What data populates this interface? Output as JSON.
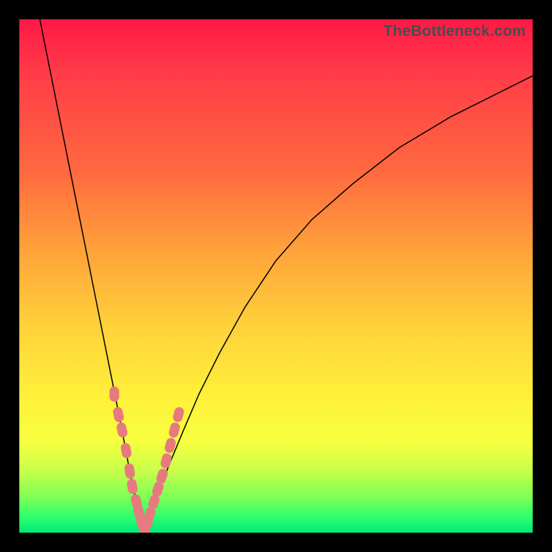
{
  "watermark": "TheBottleneck.com",
  "colors": {
    "frame": "#000000",
    "gradient_top": "#ff1846",
    "gradient_mid": "#fff13a",
    "gradient_bottom": "#00e877",
    "curve": "#000000",
    "points": "#e77a7f"
  },
  "chart_data": {
    "type": "line",
    "title": "",
    "xlabel": "",
    "ylabel": "",
    "xlim": [
      0,
      100
    ],
    "ylim": [
      0,
      100
    ],
    "grid": false,
    "series": [
      {
        "name": "left-branch",
        "x": [
          4,
          6,
          8,
          10,
          12,
          14,
          16,
          18,
          20,
          21.5,
          22.8,
          23.8,
          24.3
        ],
        "y": [
          100,
          90,
          80,
          70,
          60,
          50,
          40,
          30,
          20,
          12,
          6,
          2,
          0
        ]
      },
      {
        "name": "right-branch",
        "x": [
          24.3,
          25,
          26,
          27.5,
          29.5,
          32,
          35,
          39,
          44,
          50,
          57,
          65,
          74,
          84,
          94,
          100
        ],
        "y": [
          0,
          2,
          5,
          9,
          14,
          20,
          27,
          35,
          44,
          53,
          61,
          68,
          75,
          81,
          86,
          89
        ]
      }
    ],
    "points": {
      "name": "highlighted-data",
      "x": [
        18.5,
        19.3,
        20.0,
        20.8,
        21.5,
        22.0,
        22.8,
        23.3,
        23.8,
        24.3,
        24.8,
        25.4,
        26.2,
        27.0,
        27.8,
        28.6,
        29.4,
        30.2,
        31.0
      ],
      "y": [
        27,
        23,
        20,
        16,
        12,
        9,
        6,
        4,
        2,
        0.5,
        1.5,
        3.5,
        6,
        8.5,
        11,
        14,
        17,
        20,
        23
      ]
    }
  }
}
